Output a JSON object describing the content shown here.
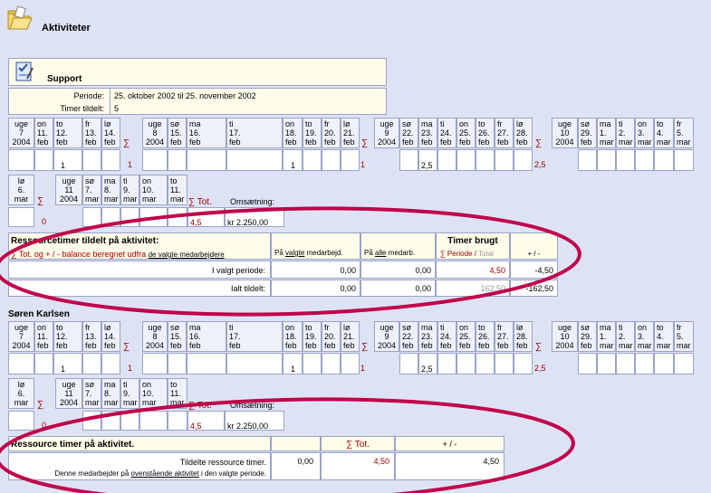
{
  "page": {
    "title": "Aktiviteter",
    "icon": "folder-open-icon"
  },
  "activity": {
    "name": "Support",
    "icon": "checklist-icon",
    "periode_label": "Periode:",
    "periode_value": "25. oktober 2002 til 25. november 2002",
    "timer_label": "Timer tildelt:",
    "timer_value": "5"
  },
  "weeks": [
    {
      "uge": "uge\n7\n2004",
      "days": [
        "on\n11.\nfeb",
        "to\n12.\nfeb",
        "fr\n13.\nfeb",
        "lø\n14.\nfeb"
      ],
      "sigma": "∑"
    },
    {
      "uge": "uge\n8\n2004",
      "days": [
        "sø\n15.\nfeb",
        "ma\n16.\nfeb",
        "ti\n17.\nfeb",
        "on\n18.\nfeb",
        "to\n19.\nfeb",
        "fr\n20.\nfeb",
        "lø\n21.\nfeb"
      ],
      "sigma": "∑"
    },
    {
      "uge": "uge\n9\n2004",
      "days": [
        "sø\n22.\nfeb",
        "ma\n23.\nfeb",
        "ti\n24.\nfeb",
        "on\n25.\nfeb",
        "to\n26.\nfeb",
        "fr\n27.\nfeb",
        "lø\n28.\nfeb"
      ],
      "sigma": "∑"
    },
    {
      "uge": "uge\n10\n2004",
      "days": [
        "sø\n29.\nfeb",
        "ma\n1.\nmar",
        "ti\n2.\nmar",
        "on\n3.\nmar",
        "to\n4.\nmar",
        "fr\n5.\nmar"
      ],
      "sigma": ""
    },
    {
      "uge": "lø\n6.\nmar",
      "sigma": "∑"
    },
    {
      "uge": "uge\n11\n2004",
      "days": [
        "sø\n7.\nmar",
        "ma\n8.\nmar",
        "ti\n9.\nmar",
        "on\n10.\nmar",
        "to\n11.\nmar"
      ]
    }
  ],
  "values": {
    "w7_to": "1",
    "w7_sum": "1",
    "w8_on": "1",
    "w8_sum": "1",
    "w9_ma": "2,5",
    "w9_sum": "2,5",
    "w10_sum": "0",
    "tot_label": "∑ Tot.",
    "tot_value": "4,5",
    "oms_label": "Omsætning:",
    "oms_value": "kr 2.250,00"
  },
  "resources": {
    "title": "Ressourcetimer tildelt på aktivitet:",
    "subtitle_pre": "∑ Tot. og + / - balance beregnet udfra ",
    "subtitle_link": "de valgte medarbejdere",
    "col1_pre": "På ",
    "col1_link": "valgte",
    "col1_post": " medarbejd.",
    "col2_pre": "På ",
    "col2_link": "alle",
    "col2_post": " medarb.",
    "col3_title": "Timer brugt",
    "col3_sub_pre": "∑ Periode / ",
    "col3_sub_total": "Total",
    "col4": "+ / -",
    "row1_label": "I valgt periode:",
    "row1": [
      "0,00",
      "0,00",
      "4,50",
      "-4,50"
    ],
    "row2_label": "Ialt tildelt:",
    "row2": [
      "0,00",
      "0,00",
      "162,50",
      "-162,50"
    ]
  },
  "person": {
    "name": "Søren Karlsen",
    "summary_title": "Ressource timer på aktivitet.",
    "col_tot": "∑ Tot.",
    "col_bal": "+ / -",
    "row_label": "Tildelte ressource timer.",
    "row_note_pre": "Denne medarbejder på ",
    "row_note_link": "ovenstående aktivitet",
    "row_note_post": " i den valgte periode.",
    "row_values": [
      "0,00",
      "4,50",
      "4,50"
    ]
  }
}
